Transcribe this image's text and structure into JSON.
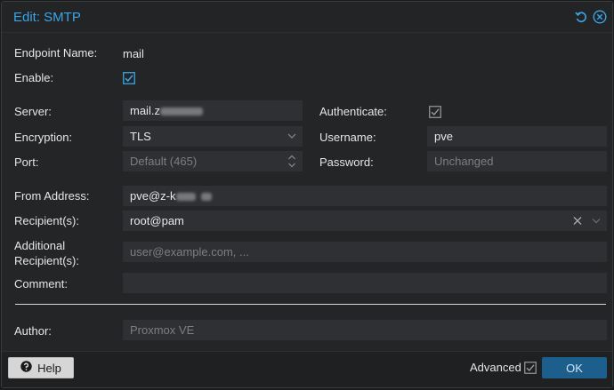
{
  "dialog": {
    "title": "Edit: SMTP",
    "reset_icon": "reset-icon",
    "close_icon": "close-icon"
  },
  "form": {
    "endpoint_name_label": "Endpoint Name:",
    "endpoint_name_value": "mail",
    "enable_label": "Enable:",
    "enable_checked": true,
    "server_label": "Server:",
    "server_value": "mail.z",
    "authenticate_label": "Authenticate:",
    "authenticate_checked": true,
    "encryption_label": "Encryption:",
    "encryption_value": "TLS",
    "username_label": "Username:",
    "username_value": "pve",
    "port_label": "Port:",
    "port_placeholder": "Default (465)",
    "password_label": "Password:",
    "password_placeholder": "Unchanged",
    "from_label": "From Address:",
    "from_value": "pve@z-k",
    "recipients_label": "Recipient(s):",
    "recipients_value": "root@pam",
    "additional_label_1": "Additional",
    "additional_label_2": "Recipient(s):",
    "additional_placeholder": "user@example.com, ...",
    "comment_label": "Comment:",
    "comment_value": "",
    "author_label": "Author:",
    "author_placeholder": "Proxmox VE"
  },
  "footer": {
    "help_label": "Help",
    "advanced_label": "Advanced",
    "advanced_checked": true,
    "ok_label": "OK"
  },
  "colors": {
    "accent": "#3aa6e8",
    "ok_button": "#1d5f8c",
    "field_bg": "#2f3033"
  }
}
